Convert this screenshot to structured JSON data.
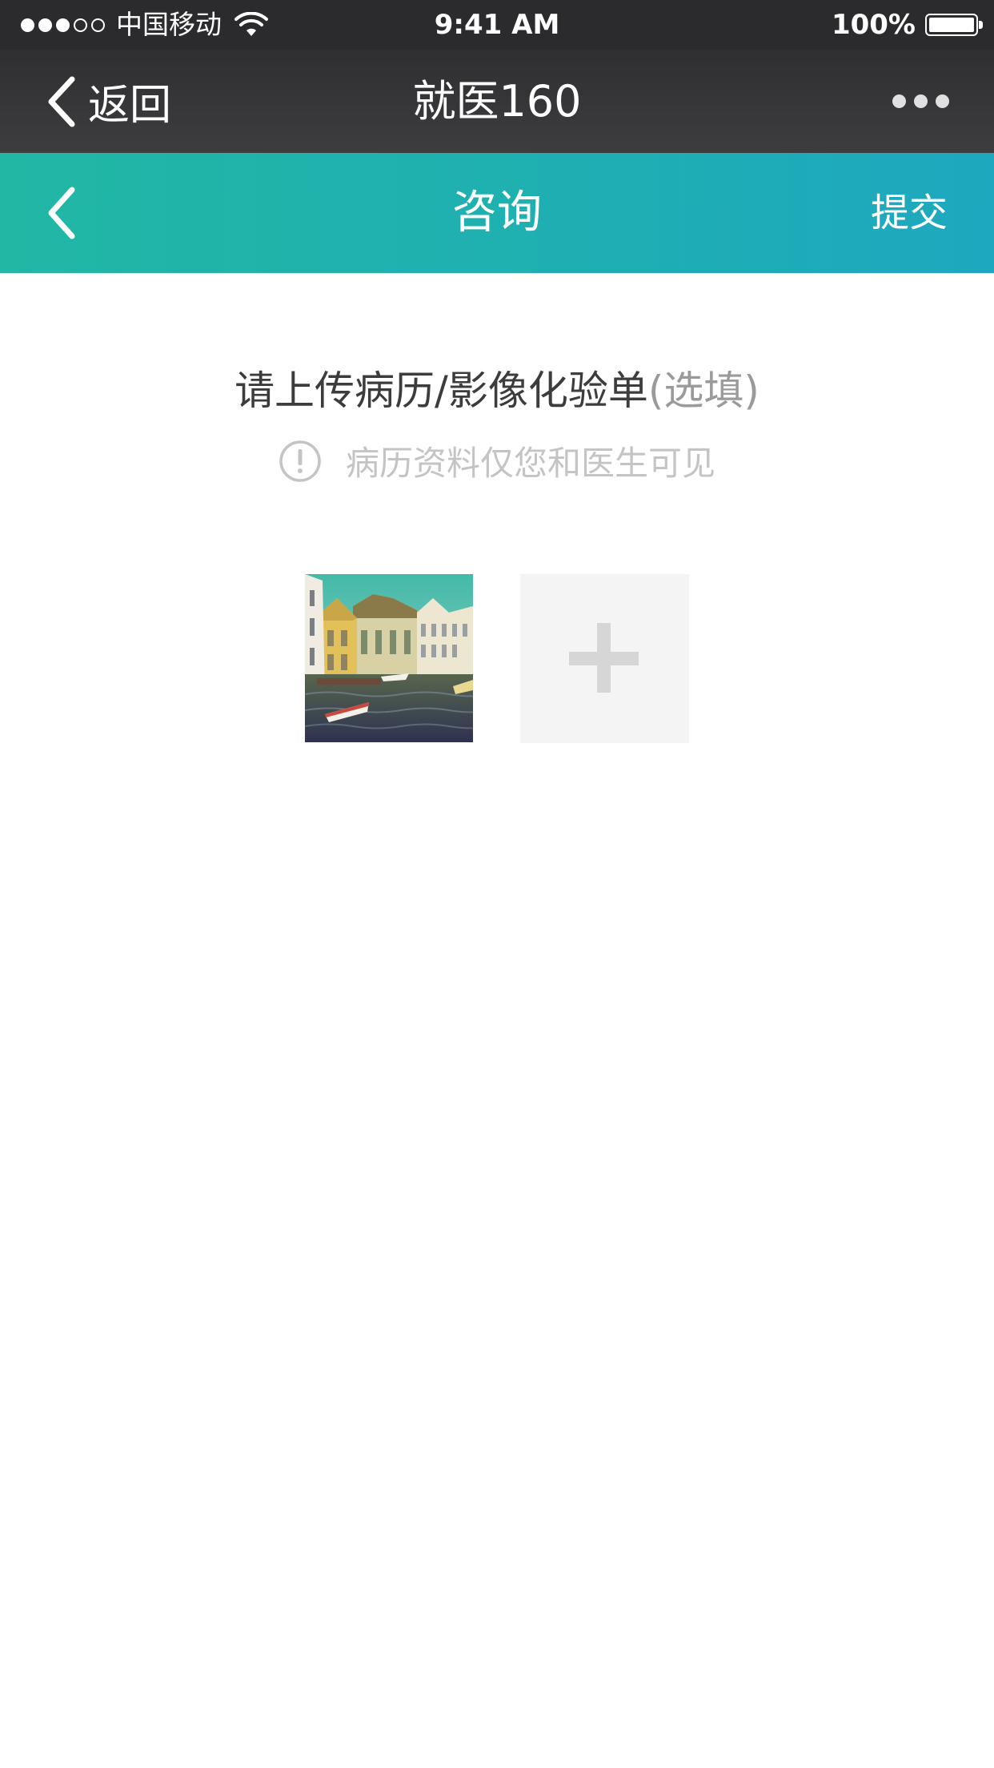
{
  "status_bar": {
    "carrier": "中国移动",
    "time": "9:41 AM",
    "battery": "100%",
    "signal_strength": 3,
    "signal_max": 5
  },
  "top_nav": {
    "back_label": "返回",
    "title": "就医160"
  },
  "header": {
    "title": "咨询",
    "submit_label": "提交",
    "gradient": [
      "#21b7a4",
      "#1ea8bf"
    ]
  },
  "upload": {
    "heading": "请上传病历/影像化验单",
    "heading_optional": "(选填)",
    "hint": "病历资料仅您和医生可见",
    "uploaded_images": 1
  },
  "icons": {
    "back": "chevron-left-icon",
    "more": "more-dots-icon",
    "hint": "exclamation-circle-icon",
    "add": "plus-icon"
  }
}
